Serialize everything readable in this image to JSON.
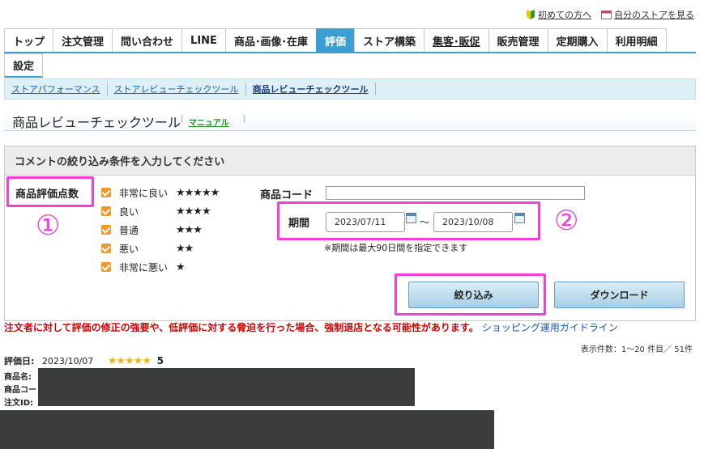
{
  "top_links": {
    "first_time": "初めての方へ",
    "my_store": "自分のストアを見る"
  },
  "tabs": [
    {
      "label": "トップ",
      "active": false,
      "underline": false
    },
    {
      "label": "注文管理",
      "active": false,
      "underline": false
    },
    {
      "label": "問い合わせ",
      "active": false,
      "underline": false
    },
    {
      "label": "LINE",
      "active": false,
      "underline": false
    },
    {
      "label": "商品･画像･在庫",
      "active": false,
      "underline": false
    },
    {
      "label": "評価",
      "active": true,
      "underline": false
    },
    {
      "label": "ストア構築",
      "active": false,
      "underline": false
    },
    {
      "label": "集客･販促",
      "active": false,
      "underline": true
    },
    {
      "label": "販売管理",
      "active": false,
      "underline": false
    },
    {
      "label": "定期購入",
      "active": false,
      "underline": false
    },
    {
      "label": "利用明細",
      "active": false,
      "underline": false
    }
  ],
  "tabs_row2": [
    {
      "label": "設定"
    }
  ],
  "subnav": [
    {
      "label": "ストアパフォーマンス",
      "current": false
    },
    {
      "label": "ストアレビューチェックツール",
      "current": false
    },
    {
      "label": "商品レビューチェックツール",
      "current": true
    }
  ],
  "page": {
    "title": "商品レビューチェックツール",
    "manual": "マニュアル",
    "bracket_open": "[",
    "bracket_close": "]"
  },
  "filter": {
    "heading": "コメントの絞り込み条件を入力してください",
    "rating_label": "商品評価点数",
    "ratings": [
      {
        "label": "非常に良い",
        "stars": "★★★★★",
        "checked": true
      },
      {
        "label": "良い",
        "stars": "★★★★",
        "checked": true
      },
      {
        "label": "普通",
        "stars": "★★★",
        "checked": true
      },
      {
        "label": "悪い",
        "stars": "★★",
        "checked": true
      },
      {
        "label": "非常に悪い",
        "stars": "★",
        "checked": true
      }
    ],
    "product_code_label": "商品コード",
    "product_code_value": "",
    "period_label": "期間",
    "date_from": "2023/07/11",
    "date_to": "2023/10/08",
    "tilde": "～",
    "period_note": "※期間は最大90日間を指定できます",
    "filter_button": "絞り込み",
    "download_button": "ダウンロード",
    "annotation_1": "①",
    "annotation_2": "②"
  },
  "warning": {
    "text": "注文者に対して評価の修正の強要や、低評価に対する脅迫を行った場合、強制退店となる可能性があります。",
    "guideline_link": "ショッピング運用ガイドライン"
  },
  "results": {
    "count_text": "表示件数：1～20 件目／ 51件"
  },
  "review": {
    "date_label": "評価日:",
    "date": "2023/10/07",
    "stars": "★★★★★",
    "score": "5",
    "product_name_label": "商品名:",
    "product_code_label": "商品コー",
    "order_id_label": "注文ID:"
  },
  "colors": {
    "accent": "#3d9fd1",
    "annotation": "#f43ed9",
    "checkbox": "#f0982c",
    "warning": "#d10000",
    "star": "#f2b01e"
  }
}
